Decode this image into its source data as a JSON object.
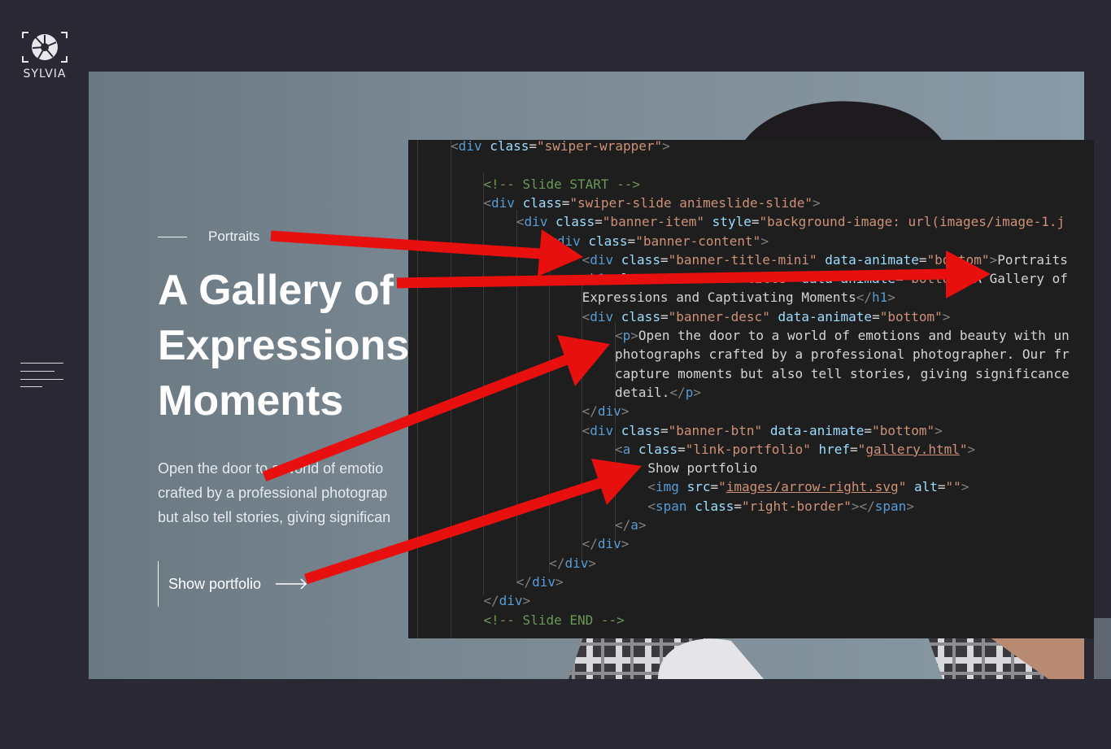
{
  "sidebar": {
    "logo_text": "SYLVIA",
    "logo_icon": "aperture-icon",
    "menu_icon": "hamburger-menu-icon"
  },
  "banner": {
    "mini_title": "Portraits",
    "title": "A Gallery of\nExpressions\nMoments",
    "desc": "Open the door to a world of emotio\ncrafted by a professional photograp\nbut also tell stories, giving significan",
    "button_label": "Show portfolio",
    "button_icon": "arrow-right-icon"
  },
  "code": {
    "lines": [
      [
        [
          "c-punct",
          "<"
        ],
        [
          "c-tag",
          "div"
        ],
        [
          "c-text",
          " "
        ],
        [
          "c-attr",
          "class"
        ],
        [
          "c-text",
          "="
        ],
        [
          "c-str",
          "\"swiper-wrapper\""
        ],
        [
          "c-punct",
          ">"
        ]
      ],
      [],
      [
        [
          "c-comment",
          "<!-- Slide START -->"
        ]
      ],
      [
        [
          "c-punct",
          "<"
        ],
        [
          "c-tag",
          "div"
        ],
        [
          "c-text",
          " "
        ],
        [
          "c-attr",
          "class"
        ],
        [
          "c-text",
          "="
        ],
        [
          "c-str",
          "\"swiper-slide animeslide-slide\""
        ],
        [
          "c-punct",
          ">"
        ]
      ],
      [
        [
          "c-punct",
          "<"
        ],
        [
          "c-tag",
          "div"
        ],
        [
          "c-text",
          " "
        ],
        [
          "c-attr",
          "class"
        ],
        [
          "c-text",
          "="
        ],
        [
          "c-str",
          "\"banner-item\""
        ],
        [
          "c-text",
          " "
        ],
        [
          "c-attr",
          "style"
        ],
        [
          "c-text",
          "="
        ],
        [
          "c-str",
          "\"background-image: url(images/image-1.j"
        ]
      ],
      [
        [
          "c-punct",
          "<"
        ],
        [
          "c-tag",
          "div"
        ],
        [
          "c-text",
          " "
        ],
        [
          "c-attr",
          "class"
        ],
        [
          "c-text",
          "="
        ],
        [
          "c-str",
          "\"banner-content\""
        ],
        [
          "c-punct",
          ">"
        ]
      ],
      [
        [
          "c-punct",
          "<"
        ],
        [
          "c-tag",
          "div"
        ],
        [
          "c-text",
          " "
        ],
        [
          "c-attr",
          "class"
        ],
        [
          "c-text",
          "="
        ],
        [
          "c-str",
          "\"banner-title-mini\""
        ],
        [
          "c-text",
          " "
        ],
        [
          "c-attr",
          "data-animate"
        ],
        [
          "c-text",
          "="
        ],
        [
          "c-str",
          "\"bottom\""
        ],
        [
          "c-punct",
          ">"
        ],
        [
          "c-text",
          "Portraits"
        ]
      ],
      [
        [
          "c-punct",
          "<"
        ],
        [
          "c-tag",
          "h1"
        ],
        [
          "c-text",
          " "
        ],
        [
          "c-attr",
          "class"
        ],
        [
          "c-text",
          "="
        ],
        [
          "c-str",
          "\"h1 banner-title\""
        ],
        [
          "c-text",
          " "
        ],
        [
          "c-attr",
          "data-animate"
        ],
        [
          "c-text",
          "="
        ],
        [
          "c-str",
          "\"bottom\""
        ],
        [
          "c-punct",
          ">"
        ],
        [
          "c-text",
          "A Gallery of"
        ]
      ],
      [
        [
          "c-text",
          "Expressions and Captivating Moments"
        ],
        [
          "c-punct",
          "</"
        ],
        [
          "c-tag",
          "h1"
        ],
        [
          "c-punct",
          ">"
        ]
      ],
      [
        [
          "c-punct",
          "<"
        ],
        [
          "c-tag",
          "div"
        ],
        [
          "c-text",
          " "
        ],
        [
          "c-attr",
          "class"
        ],
        [
          "c-text",
          "="
        ],
        [
          "c-str",
          "\"banner-desc\""
        ],
        [
          "c-text",
          " "
        ],
        [
          "c-attr",
          "data-animate"
        ],
        [
          "c-text",
          "="
        ],
        [
          "c-str",
          "\"bottom\""
        ],
        [
          "c-punct",
          ">"
        ]
      ],
      [
        [
          "c-punct",
          "<"
        ],
        [
          "c-tag",
          "p"
        ],
        [
          "c-punct",
          ">"
        ],
        [
          "c-text",
          "Open the door to a world of emotions and beauty with un"
        ]
      ],
      [
        [
          "c-text",
          "photographs crafted by a professional photographer. Our fr"
        ]
      ],
      [
        [
          "c-text",
          "capture moments but also tell stories, giving significance"
        ]
      ],
      [
        [
          "c-text",
          "detail."
        ],
        [
          "c-punct",
          "</"
        ],
        [
          "c-tag",
          "p"
        ],
        [
          "c-punct",
          ">"
        ]
      ],
      [
        [
          "c-punct",
          "</"
        ],
        [
          "c-tag",
          "div"
        ],
        [
          "c-punct",
          ">"
        ]
      ],
      [
        [
          "c-punct",
          "<"
        ],
        [
          "c-tag",
          "div"
        ],
        [
          "c-text",
          " "
        ],
        [
          "c-attr",
          "class"
        ],
        [
          "c-text",
          "="
        ],
        [
          "c-str",
          "\"banner-btn\""
        ],
        [
          "c-text",
          " "
        ],
        [
          "c-attr",
          "data-animate"
        ],
        [
          "c-text",
          "="
        ],
        [
          "c-str",
          "\"bottom\""
        ],
        [
          "c-punct",
          ">"
        ]
      ],
      [
        [
          "c-punct",
          "<"
        ],
        [
          "c-tag",
          "a"
        ],
        [
          "c-text",
          " "
        ],
        [
          "c-attr",
          "class"
        ],
        [
          "c-text",
          "="
        ],
        [
          "c-str",
          "\"link-portfolio\""
        ],
        [
          "c-text",
          " "
        ],
        [
          "c-attr",
          "href"
        ],
        [
          "c-text",
          "="
        ],
        [
          "c-str",
          "\""
        ],
        [
          "c-link",
          "gallery.html"
        ],
        [
          "c-str",
          "\""
        ],
        [
          "c-punct",
          ">"
        ]
      ],
      [
        [
          "c-text",
          "Show portfolio"
        ]
      ],
      [
        [
          "c-punct",
          "<"
        ],
        [
          "c-tag",
          "img"
        ],
        [
          "c-text",
          " "
        ],
        [
          "c-attr",
          "src"
        ],
        [
          "c-text",
          "="
        ],
        [
          "c-str",
          "\""
        ],
        [
          "c-link",
          "images/arrow-right.svg"
        ],
        [
          "c-str",
          "\""
        ],
        [
          "c-text",
          " "
        ],
        [
          "c-attr",
          "alt"
        ],
        [
          "c-text",
          "="
        ],
        [
          "c-str",
          "\"\""
        ],
        [
          "c-punct",
          ">"
        ]
      ],
      [
        [
          "c-punct",
          "<"
        ],
        [
          "c-tag",
          "span"
        ],
        [
          "c-text",
          " "
        ],
        [
          "c-attr",
          "class"
        ],
        [
          "c-text",
          "="
        ],
        [
          "c-str",
          "\"right-border\""
        ],
        [
          "c-punct",
          "></"
        ],
        [
          "c-tag",
          "span"
        ],
        [
          "c-punct",
          ">"
        ]
      ],
      [
        [
          "c-punct",
          "</"
        ],
        [
          "c-tag",
          "a"
        ],
        [
          "c-punct",
          ">"
        ]
      ],
      [
        [
          "c-punct",
          "</"
        ],
        [
          "c-tag",
          "div"
        ],
        [
          "c-punct",
          ">"
        ]
      ],
      [
        [
          "c-punct",
          "</"
        ],
        [
          "c-tag",
          "div"
        ],
        [
          "c-punct",
          ">"
        ]
      ],
      [
        [
          "c-punct",
          "</"
        ],
        [
          "c-tag",
          "div"
        ],
        [
          "c-punct",
          ">"
        ]
      ],
      [
        [
          "c-punct",
          "</"
        ],
        [
          "c-tag",
          "div"
        ],
        [
          "c-punct",
          ">"
        ]
      ],
      [
        [
          "c-comment",
          "<!-- Slide END -->"
        ]
      ]
    ]
  },
  "annotation": {
    "arrow_color": "#e8100f",
    "arrow_icon": "red-arrow-icon"
  }
}
